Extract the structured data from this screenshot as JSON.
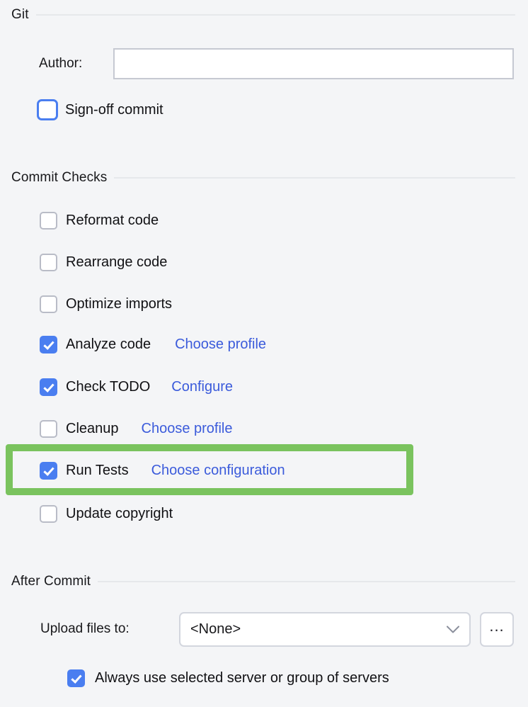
{
  "sections": {
    "git": {
      "title": "Git",
      "author": {
        "label": "Author:",
        "value": "",
        "placeholder": ""
      },
      "sign_off": {
        "label": "Sign-off commit",
        "checked": false,
        "focused": true
      }
    },
    "commit_checks": {
      "title": "Commit Checks",
      "items": [
        {
          "label": "Reformat code",
          "checked": false,
          "action": ""
        },
        {
          "label": "Rearrange code",
          "checked": false,
          "action": ""
        },
        {
          "label": "Optimize imports",
          "checked": false,
          "action": ""
        },
        {
          "label": "Analyze code",
          "checked": true,
          "action": "Choose profile"
        },
        {
          "label": "Check TODO",
          "checked": true,
          "action": "Configure"
        },
        {
          "label": "Cleanup",
          "checked": false,
          "action": "Choose profile"
        },
        {
          "label": "Run Tests",
          "checked": true,
          "action": "Choose configuration"
        },
        {
          "label": "Update copyright",
          "checked": false,
          "action": ""
        }
      ]
    },
    "after_commit": {
      "title": "After Commit",
      "upload": {
        "label": "Upload files to:",
        "selected": "<None>",
        "browse_label": "..."
      },
      "always_use": {
        "label": "Always use selected server or group of servers",
        "checked": true
      }
    }
  },
  "annotation": {
    "highlight_color": "#7ac35e",
    "target": "Run Tests"
  },
  "colors": {
    "background": "#f4f5f7",
    "link": "#3B5BDB",
    "checkbox_accent": "#4a7ef0",
    "rule": "#e6e8eb"
  }
}
